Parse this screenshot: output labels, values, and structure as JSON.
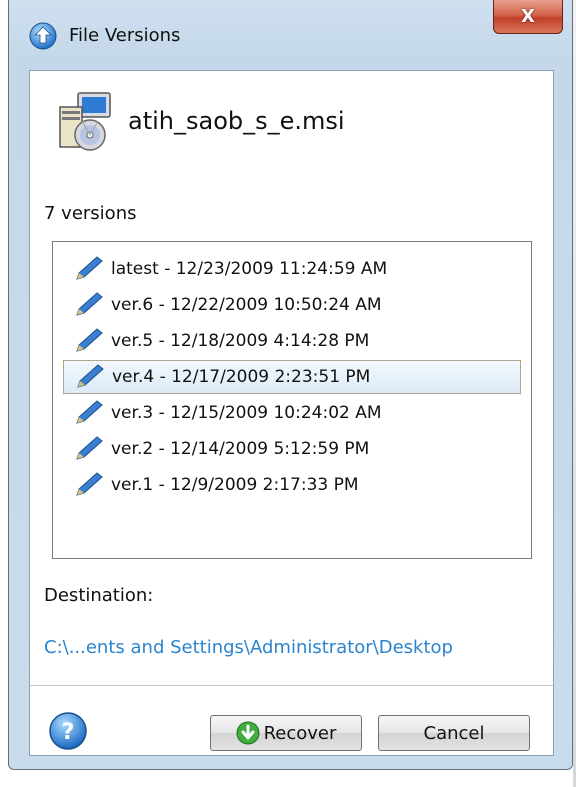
{
  "window": {
    "title": "File Versions",
    "close_label": "X"
  },
  "file": {
    "name": "atih_saob_s_e.msi"
  },
  "versions": {
    "count_label": "7 versions",
    "items": [
      {
        "label": "latest - 12/23/2009 11:24:59 AM"
      },
      {
        "label": "ver.6 - 12/22/2009 10:50:24 AM"
      },
      {
        "label": "ver.5 - 12/18/2009 4:14:28 PM"
      },
      {
        "label": "ver.4 - 12/17/2009 2:23:51 PM"
      },
      {
        "label": "ver.3 - 12/15/2009 10:24:02 AM"
      },
      {
        "label": "ver.2 - 12/14/2009 5:12:59 PM"
      },
      {
        "label": "ver.1 - 12/9/2009 2:17:33 PM"
      }
    ],
    "selected_index": 3
  },
  "destination": {
    "label": "Destination:",
    "path": "C:\\...ents and Settings\\Administrator\\Desktop"
  },
  "buttons": {
    "recover_label": "Recover",
    "cancel_label": "Cancel"
  },
  "icons": {
    "app": "file-versions-icon",
    "file": "msi-installer-icon",
    "version": "pencil-icon",
    "help": "help-icon",
    "recover": "recover-arrow-icon"
  },
  "colors": {
    "link": "#2b84d0",
    "close_button": "#c0402a",
    "selection_border": "#9ec4e6"
  }
}
